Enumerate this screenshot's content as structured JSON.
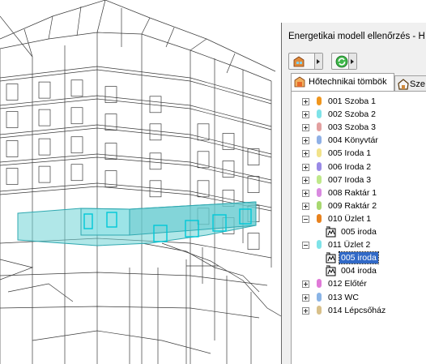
{
  "window": {
    "title": "Energetikai modell ellenőrzés - H"
  },
  "toolbar": {
    "buttons": [
      {
        "icon": "building-settings-icon"
      },
      {
        "icon": "refresh-icon"
      }
    ]
  },
  "tabs": [
    {
      "label": "Hőtechnikai tömbök",
      "icon": "thermal-blocks-icon",
      "active": true
    },
    {
      "label": "Sze",
      "icon": "structures-icon",
      "active": false
    }
  ],
  "tree": {
    "items": [
      {
        "label": "001 Szoba 1",
        "color": "#f0961e",
        "expanded": false
      },
      {
        "label": "002 Szoba 2",
        "color": "#7fe3e8",
        "expanded": false
      },
      {
        "label": "003 Szoba 3",
        "color": "#e3a0a0",
        "expanded": false
      },
      {
        "label": "004 Könyvtár",
        "color": "#8fb0e6",
        "expanded": false
      },
      {
        "label": "005 Iroda 1",
        "color": "#f2e38a",
        "expanded": false
      },
      {
        "label": "006 Iroda 2",
        "color": "#9a8ae6",
        "expanded": false
      },
      {
        "label": "007 Iroda 3",
        "color": "#bfe88a",
        "expanded": false
      },
      {
        "label": "008 Raktár 1",
        "color": "#d98ae0",
        "expanded": false
      },
      {
        "label": "009 Raktár 2",
        "color": "#a8d870",
        "expanded": false
      },
      {
        "label": "010 Üzlet 1",
        "color": "#e8821e",
        "expanded": true,
        "children": [
          {
            "label": "005 iroda",
            "selected": false
          }
        ]
      },
      {
        "label": "011 Üzlet 2",
        "color": "#7fe3e8",
        "expanded": true,
        "children": [
          {
            "label": "005 iroda",
            "selected": true
          },
          {
            "label": "004 iroda",
            "selected": false
          }
        ]
      },
      {
        "label": "012 Előtér",
        "color": "#e07ad8",
        "expanded": false
      },
      {
        "label": "013 WC",
        "color": "#8ab4e6",
        "expanded": false
      },
      {
        "label": "014 Lépcsőház",
        "color": "#d8c08a",
        "expanded": false
      }
    ]
  }
}
